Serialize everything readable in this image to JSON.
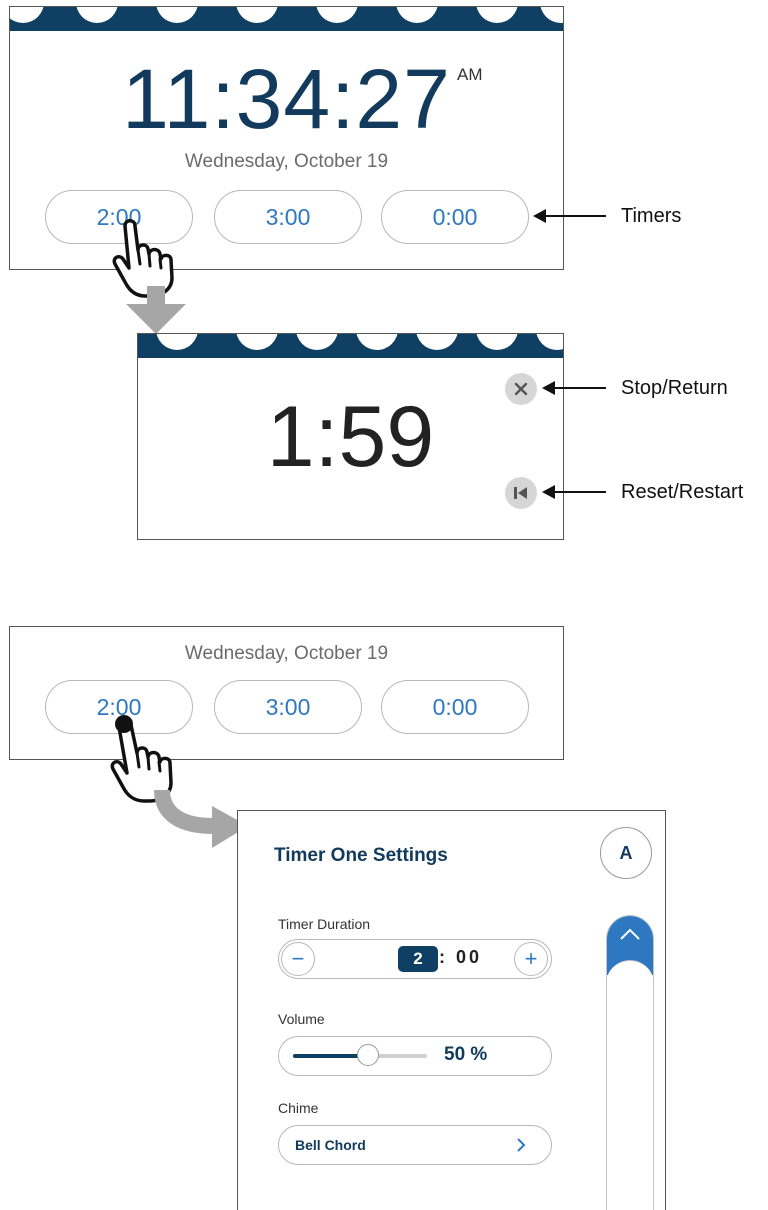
{
  "clock": {
    "time": "11:34:27",
    "ampm": "AM",
    "date": "Wednesday, October 19"
  },
  "timers": [
    "2:00",
    "3:00",
    "0:00"
  ],
  "countdown": "1:59",
  "callouts": {
    "timers": "Timers",
    "stop": "Stop/Return",
    "reset": "Reset/Restart"
  },
  "lower": {
    "date": "Wednesday, October 19",
    "timers": [
      "2:00",
      "3:00",
      "0:00"
    ]
  },
  "settings": {
    "title": "Timer One Settings",
    "avatar": "A",
    "duration_label": "Timer Duration",
    "minutes": "2",
    "seconds": ": 00",
    "minus": "−",
    "plus": "+",
    "volume_label": "Volume",
    "volume_text": "50 %",
    "volume_level": 0.5,
    "chime_label": "Chime",
    "chime_value": "Bell Chord"
  },
  "colors": {
    "navy": "#0f3f63",
    "accent": "#2e78c2",
    "arrow_gray": "#a6a6a6"
  },
  "icons": [
    "pointing-hand-icon",
    "close-icon",
    "skip-back-icon",
    "chevron-right-icon",
    "chevron-up-icon",
    "flow-arrow-icon"
  ]
}
